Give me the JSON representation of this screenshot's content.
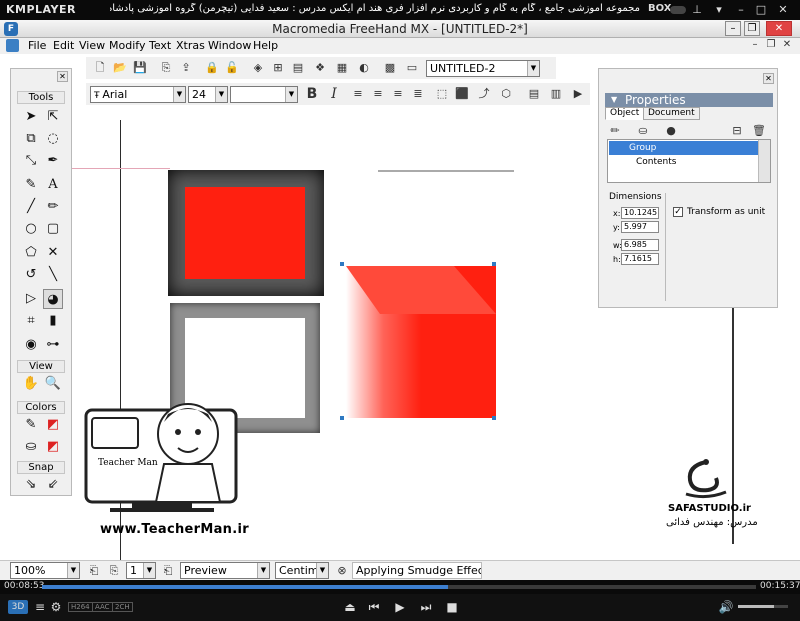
{
  "player": {
    "logo": "KMPLAYER",
    "title": "مجموعه آموزشی جامع ، گام به گام و کاربردی نرم افزار فری هند ام ایکس مدرس : سعید فدایی (تیچرمن) گروه آموزشی پادشاه گرافیست ها",
    "box_label": "BOX",
    "time_elapsed": "00:08:53",
    "time_total": "00:15:37",
    "progress": 0.569,
    "volume": 0.72,
    "mode_label": "3D",
    "chips": [
      "H264",
      "AAC",
      "2CH"
    ]
  },
  "app": {
    "title": "Macromedia FreeHand MX - [UNTITLED-2*]",
    "menus": [
      "File",
      "Edit",
      "View",
      "Modify",
      "Text",
      "Xtras",
      "Window",
      "Help"
    ]
  },
  "toolbar": {
    "document_name": "UNTITLED-2",
    "font_name": "Arial",
    "font_size": "24",
    "font_style": ""
  },
  "tools_panel": {
    "title": "Tools",
    "sections": [
      "View",
      "Colors",
      "Snap"
    ]
  },
  "properties": {
    "title": "Properties",
    "tabs": [
      "Object",
      "Document"
    ],
    "tree": [
      "Group",
      "Contents"
    ],
    "dimensions_label": "Dimensions",
    "fields": [
      {
        "key": "x:",
        "value": "10.1245"
      },
      {
        "key": "y:",
        "value": "5.997"
      },
      {
        "key": "w:",
        "value": "6.985"
      },
      {
        "key": "h:",
        "value": "7.1615"
      }
    ],
    "transform_label": "Transform as unit",
    "transform_checked": true
  },
  "status": {
    "zoom": "100%",
    "page": "1",
    "view_mode": "Preview",
    "units": "Centimeters",
    "message": "Applying Smudge Effect..."
  },
  "watermarks": {
    "teacher_url": "www.TeacherMan.ir",
    "teacher_brand": "Teacher Man",
    "studio_url": "SAFASTUDIO.ir",
    "studio_teacher": "مدرس: مهندس فدائی"
  },
  "colors": {
    "red": "#ff2010",
    "selection": "#2f79c2",
    "progress": "#3d7fd0"
  }
}
